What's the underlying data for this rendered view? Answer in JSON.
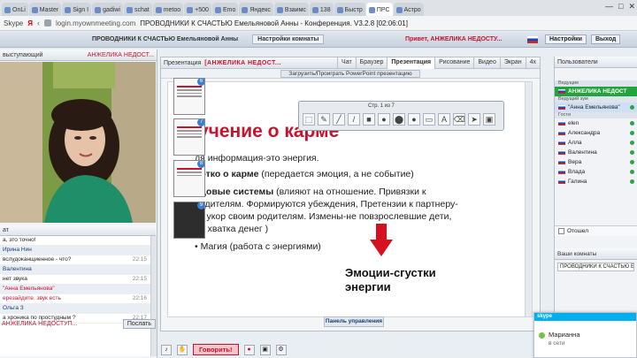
{
  "browser": {
    "tabs": [
      "OnLi",
      "Master",
      "Sign I",
      "gadiwi",
      "schat",
      "metoo",
      "+500",
      "Emo",
      "Яндекс",
      "Взаимс",
      "138",
      "Быстр",
      "ПРС",
      "Астро"
    ],
    "window_controls": [
      "—",
      "□",
      "✕"
    ],
    "skype_label": "Skype",
    "ya_label": "Я",
    "url": "login.myownmeeting.com",
    "page_title": "ПРОВОДНИКИ К СЧАСТЬЮ Емельяновой Анны - Конференция. V3.2.8 [02:06:01]"
  },
  "app_header": {
    "room_name": "ПРОВОДНИКИ К СЧАСТЬЮ Емельяновой Анны",
    "room_settings": "Настройки комнаты",
    "greeting": "Привет, АНЖЕЛИКА НЕДОСТУ...",
    "settings": "Настройки",
    "exit": "Выход"
  },
  "left": {
    "speaker_title": "выступающий",
    "speaker_name": "АНЖЕЛИКА НЕДОСТ...",
    "chat_title": "ат",
    "messages": [
      {
        "text": "а, это точно!",
        "time": "",
        "kind": "text"
      },
      {
        "text": "Ирина Нин",
        "time": "",
        "kind": "name"
      },
      {
        "text": "вслудоканщиенное - что?",
        "time": "22:15",
        "kind": "text"
      },
      {
        "text": "Валентина",
        "time": "",
        "kind": "name"
      },
      {
        "text": "нет звука",
        "time": "22:15",
        "kind": "text"
      },
      {
        "text": "\"Анна Емельянова\"",
        "time": "",
        "kind": "name-red"
      },
      {
        "text": "ерезайдите. звук есть",
        "time": "22:16",
        "kind": "text-red"
      },
      {
        "text": "Ольга З",
        "time": "",
        "kind": "name"
      },
      {
        "text": "а хроника по простудным ?",
        "time": "22:17",
        "kind": "text"
      }
    ],
    "input_name": "АНЖЕЛИКА НЕДОСТУП...",
    "send_label": "Послать"
  },
  "center": {
    "label": "Презентация",
    "presenter": "[АНЖЕЛИКА НЕДОСТ...",
    "tabs": [
      "Чат",
      "Браузер",
      "Презентация",
      "Рисование",
      "Видео",
      "Экран",
      "4x"
    ],
    "active_tab": "Презентация",
    "load_label": "Загрузить/Проиграть PowerPoint презентацию",
    "page_indicator": "Стр. 1 из 7",
    "thumb_numbers": [
      "6",
      "7",
      "8",
      "9"
    ],
    "slide": {
      "heading": "учение о карме",
      "line1": "ля информация-это энергия.",
      "line2_bold": "ротко о карме",
      "line2_rest": " (передается эмоция, а не событие)",
      "line3_bold": "одовые системы",
      "line3_rest": " (влияют на отношение. Привязки к",
      "line4": "родителям. Формируются убеждения, Претензии к партнеру-",
      "line5": "то укор своим родителям. Измены-не повзрослевшие дети,",
      "line6": "ие хватка денег )",
      "line7": "Магия (работа с энергиями)",
      "emotions": "Эмоции-сгустки энергии"
    },
    "control_panel": "Панель управления"
  },
  "right": {
    "title": "Пользователи",
    "group_leaders": "Ведущие",
    "group_host": "Ведущий зум",
    "group_guests": "Гости",
    "users": [
      {
        "name": "АНЖЕЛИКА НЕДОСТ",
        "role": "me"
      },
      {
        "name": "\"Анна Емельянова\"",
        "role": "sel"
      },
      {
        "name": "elen",
        "role": ""
      },
      {
        "name": "Александра",
        "role": ""
      },
      {
        "name": "Алла",
        "role": ""
      },
      {
        "name": "Валентина",
        "role": ""
      },
      {
        "name": "Вера",
        "role": ""
      },
      {
        "name": "Влада",
        "role": ""
      },
      {
        "name": "Галина",
        "role": ""
      }
    ],
    "leave_label": "Отошел",
    "room_links_title": "Ваши комнаты",
    "room_link": "ПРОВОДНИКИ К СЧАСТЬЮ Е"
  },
  "bottom": {
    "speak_label": "Говорить!"
  },
  "skype_popup": {
    "brand": "skype",
    "name": "Марианна",
    "status": "в сети"
  },
  "colors": {
    "accent_red": "#c8132f",
    "online_green": "#21a43b",
    "skype_blue": "#00aff0"
  }
}
